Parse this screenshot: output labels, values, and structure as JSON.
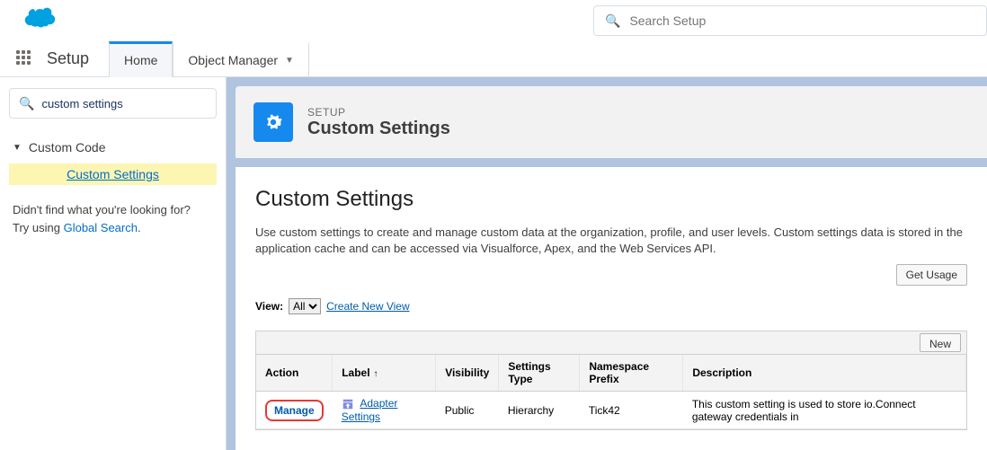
{
  "header": {
    "global_search_placeholder": "Search Setup",
    "app_name": "Setup",
    "tabs": {
      "home": "Home",
      "object_manager": "Object Manager"
    }
  },
  "sidebar": {
    "quick_find_value": "custom settings",
    "group_label": "Custom Code",
    "item_label": "Custom Settings",
    "footer_line1": "Didn't find what you're looking for?",
    "footer_line2_prefix": "Try using ",
    "footer_link": "Global Search",
    "footer_line2_suffix": "."
  },
  "page_header": {
    "eyebrow": "SETUP",
    "title": "Custom Settings"
  },
  "content": {
    "heading": "Custom Settings",
    "description": "Use custom settings to create and manage custom data at the organization, profile, and user levels. Custom settings data is stored in the application cache and can be accessed via Visualforce, Apex, and the Web Services API.",
    "get_usage": "Get Usage",
    "view_label": "View:",
    "view_select": "All",
    "create_new_view": "Create New View",
    "new_button": "New"
  },
  "table": {
    "cols": {
      "action": "Action",
      "label": "Label",
      "visibility": "Visibility",
      "settings_type": "Settings Type",
      "namespace": "Namespace Prefix",
      "description": "Description"
    },
    "row": {
      "action": "Manage",
      "label": "Adapter Settings",
      "visibility": "Public",
      "settings_type": "Hierarchy",
      "namespace": "Tick42",
      "description": "This custom setting is used to store io.Connect gateway credentials in"
    }
  }
}
